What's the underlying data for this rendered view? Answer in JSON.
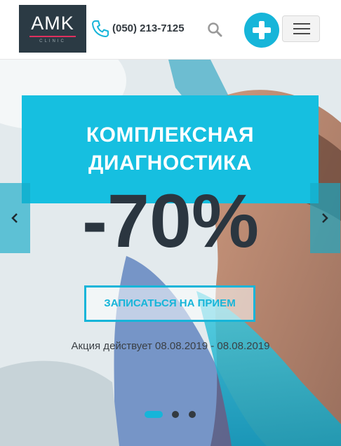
{
  "header": {
    "logo": {
      "title": "AMK",
      "subtitle": "CLINIC"
    },
    "phone": "(050) 213-7125"
  },
  "hero": {
    "title_line1": "КОМПЛЕКСНАЯ",
    "title_line2": "ДИАГНОСТИКА",
    "discount": "-70%",
    "cta_label": "ЗАПИСАТЬСЯ НА ПРИЕМ",
    "promo_dates": "Акция действует 08.08.2019 - 08.08.2019",
    "slides_total": 3,
    "active_slide": 1
  },
  "colors": {
    "accent": "#16b5d9",
    "title_box": "#16bfe0",
    "logo_bg": "#2b3a44",
    "logo_line": "#e0305e",
    "dark_text": "#2b3640"
  },
  "icons": [
    "phone-icon",
    "search-icon",
    "plus-icon",
    "hamburger-menu-icon",
    "chevron-left-icon",
    "chevron-right-icon"
  ]
}
